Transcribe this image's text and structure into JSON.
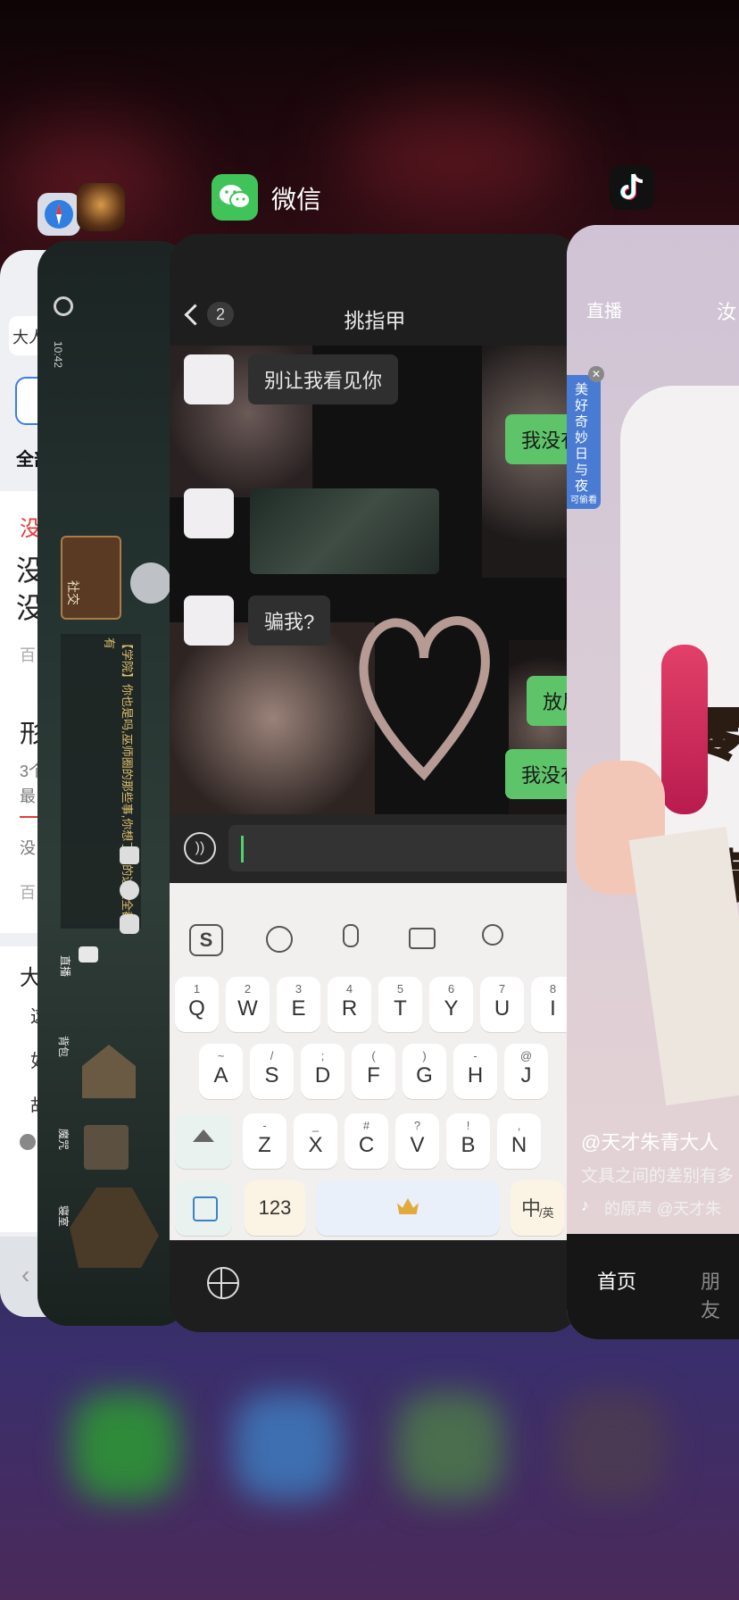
{
  "wechat": {
    "app_label": "微信",
    "back_count": "2",
    "chat_title": "挑指甲",
    "messages": {
      "m1": "别让我看见你",
      "m2": "我没有",
      "m3": "骗我?",
      "m4": "放屁",
      "m5": "我没有"
    },
    "input_value": ""
  },
  "keyboard": {
    "row1": [
      {
        "hint": "1",
        "key": "Q"
      },
      {
        "hint": "2",
        "key": "W"
      },
      {
        "hint": "3",
        "key": "E"
      },
      {
        "hint": "4",
        "key": "R"
      },
      {
        "hint": "5",
        "key": "T"
      },
      {
        "hint": "6",
        "key": "Y"
      },
      {
        "hint": "7",
        "key": "U"
      },
      {
        "hint": "8",
        "key": "I"
      }
    ],
    "row2": [
      {
        "hint": "~",
        "key": "A"
      },
      {
        "hint": "/",
        "key": "S"
      },
      {
        "hint": ";",
        "key": "D"
      },
      {
        "hint": "(",
        "key": "F"
      },
      {
        "hint": ")",
        "key": "G"
      },
      {
        "hint": "-",
        "key": "H"
      },
      {
        "hint": "@",
        "key": "J"
      }
    ],
    "row3": [
      {
        "hint": "-",
        "key": "Z"
      },
      {
        "hint": "_",
        "key": "X"
      },
      {
        "hint": "#",
        "key": "C"
      },
      {
        "hint": "?",
        "key": "V"
      },
      {
        "hint": "!",
        "key": "B"
      },
      {
        "hint": ",",
        "key": "N"
      }
    ],
    "num_key": "123",
    "lang_key_main": "中",
    "lang_key_sub": "/英"
  },
  "game": {
    "time": "10:42",
    "social": "社交",
    "notice": "【学院】你也是吗,巫师圈的那些事,你想了解的这里全都有",
    "live": "直播",
    "bag": "背包",
    "academy": "魔咒",
    "room": "寝室"
  },
  "baidu": {
    "search_text": "大人",
    "tab": "全部",
    "red_text": "没",
    "big1": "没",
    "big2": "没",
    "small1": "百",
    "title2": "形",
    "line1": "3个",
    "line2": "最",
    "line3": "没",
    "small2": "百",
    "section": "大",
    "item1": "这",
    "item2": "如",
    "item3": "故"
  },
  "tiktok": {
    "top_tab": "直播",
    "top_tab2": "汝",
    "badge_text": "美好奇妙日与夜",
    "badge_sub": "可偷看",
    "caption1": "零",
    "caption2": "满",
    "author": "@天才朱青大人",
    "desc": "文具之间的差别有多",
    "music": "的原声 @天才朱",
    "nav_home": "首页",
    "nav_friends": "朋友"
  }
}
